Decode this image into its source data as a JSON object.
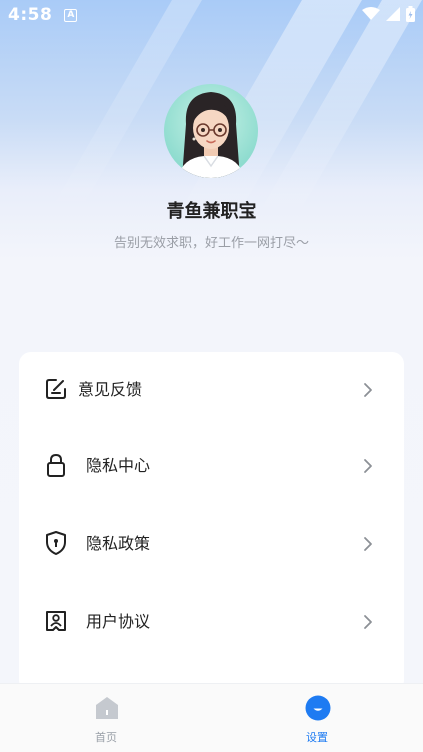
{
  "status_bar": {
    "time": "4:58"
  },
  "profile": {
    "app_name": "青鱼兼职宝",
    "slogan": "告别无效求职，好工作一网打尽～"
  },
  "menu": [
    {
      "label": "意见反馈",
      "icon": "edit-icon"
    },
    {
      "label": "隐私中心",
      "icon": "lock-icon"
    },
    {
      "label": "隐私政策",
      "icon": "shield-icon"
    },
    {
      "label": "用户协议",
      "icon": "user-document-icon"
    }
  ],
  "tabbar": {
    "home": {
      "label": "首页",
      "icon": "home-icon"
    },
    "settings": {
      "label": "设置",
      "icon": "settings-icon"
    }
  },
  "colors": {
    "accent": "#1e7bf2",
    "inactive_tab": "#9aa0a8"
  }
}
